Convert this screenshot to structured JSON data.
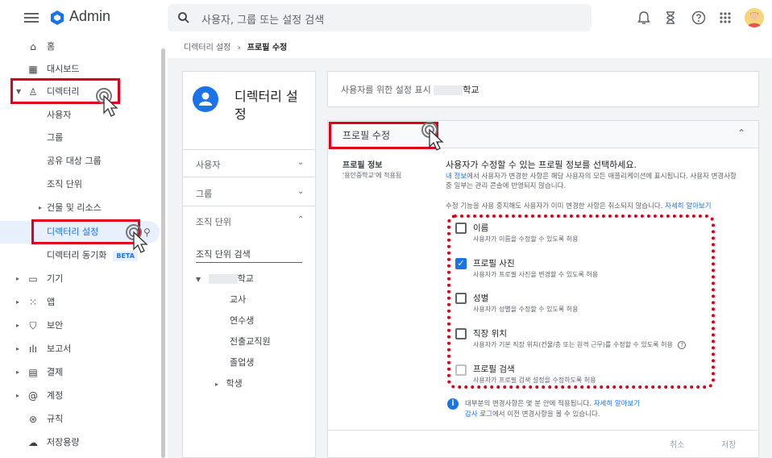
{
  "topbar": {
    "app_name": "Admin",
    "search_placeholder": "사용자, 그룹 또는 설정 검색",
    "icons": [
      "bell-icon",
      "hourglass-icon",
      "help-icon",
      "apps-icon"
    ]
  },
  "sidebar": {
    "items": [
      {
        "label": "홈",
        "icon": "home-icon"
      },
      {
        "label": "대시보드",
        "icon": "dashboard-icon"
      },
      {
        "label": "디렉터리",
        "icon": "person-icon"
      },
      {
        "label": "사용자"
      },
      {
        "label": "그룹"
      },
      {
        "label": "공유 대상 그룹"
      },
      {
        "label": "조직 단위"
      },
      {
        "label": "건물 및 리소스"
      },
      {
        "label": "디렉터리 설정"
      },
      {
        "label": "디렉터리 동기화",
        "badge": "BETA"
      },
      {
        "label": "기기",
        "icon": "devices-icon"
      },
      {
        "label": "앱",
        "icon": "apps-grid-icon"
      },
      {
        "label": "보안",
        "icon": "shield-icon"
      },
      {
        "label": "보고서",
        "icon": "bar-chart-icon"
      },
      {
        "label": "결제",
        "icon": "card-icon"
      },
      {
        "label": "계정",
        "icon": "at-icon"
      },
      {
        "label": "규칙",
        "icon": "steering-icon"
      },
      {
        "label": "저장용량",
        "icon": "cloud-icon"
      }
    ]
  },
  "breadcrumb": {
    "parent": "디렉터리 설정",
    "sep": "›",
    "current": "프로필 수정"
  },
  "left_panel": {
    "title": "디렉터리 설정",
    "rows": [
      "사용자",
      "그룹",
      "조직 단위"
    ],
    "ou_search": "조직 단위 검색",
    "tree": [
      "학교",
      "교사",
      "연수생",
      "전출교직원",
      "졸업생",
      "학생"
    ]
  },
  "display_panel": {
    "label": "사용자를 위한 설정 표시",
    "school": "학교"
  },
  "profile_panel": {
    "header": "프로필 수정",
    "section_label": "프로필 정보",
    "section_sub": "'용안중학교'에 적용됨",
    "heading": "사용자가 수정할 수 있는 프로필 정보를 선택하세요.",
    "desc_link": "내 정보",
    "desc_rest": "에서 사용자가 변경한 사항은 해당 사용자의 모든 애플리케이션에 표시됩니다. 사용자 변경사항 중 일부는 관리 콘솔에 반영되지 않습니다.",
    "note": "수정 기능을 사용 중지해도 사용자가 이미 변경한 사항은 취소되지 않습니다.",
    "note_link": "자세히 알아보기",
    "options": [
      {
        "title": "이름",
        "desc": "사용자가 이름을 수정할 수 있도록 허용",
        "checked": false
      },
      {
        "title": "프로필 사진",
        "desc": "사용자가 프로필 사진을 변경할 수 있도록 허용",
        "checked": true
      },
      {
        "title": "성별",
        "desc": "사용자가 성별을 수정할 수 있도록 허용",
        "checked": false
      },
      {
        "title": "직장 위치",
        "desc": "사용자가 기본 직장 위치(건물/층 또는 원격 근무)를 수정할 수 있도록 허용",
        "checked": false
      },
      {
        "title": "프로필 검색",
        "desc": "사용자가 프로필 검색 설정을 수정하도록 허용",
        "checked": false
      }
    ],
    "info1": "대부분의 변경사항은 몇 분 안에 적용됩니다.",
    "info1_link": "자세히 알아보기",
    "info2_link": "감사 로그",
    "info2": "에서 이전 변경사항을 볼 수 있습니다.",
    "cancel": "취소",
    "save": "저장"
  }
}
